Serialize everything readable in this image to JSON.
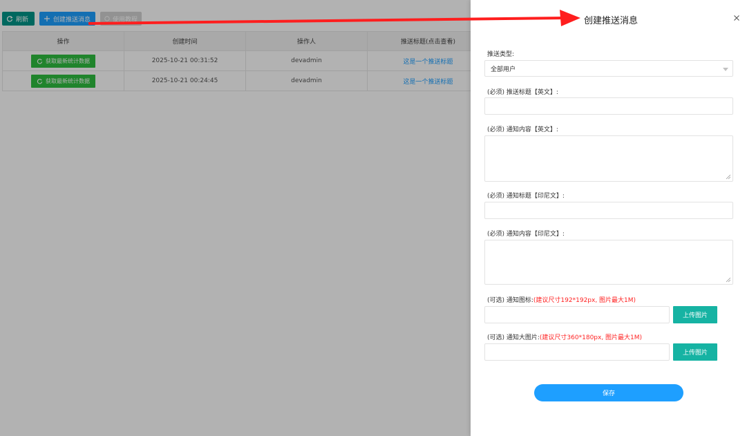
{
  "toolbar": {
    "refresh_label": "刷新",
    "create_label": "创建推送消息",
    "tutorial_label": "使用教程"
  },
  "table": {
    "headers": [
      "操作",
      "创建时间",
      "操作人",
      "推送标题(点击查看)"
    ],
    "rows": [
      {
        "action": "获取最新统计数据",
        "created": "2025-10-21 00:31:52",
        "operator": "devadmin",
        "title": "这是一个推送标题"
      },
      {
        "action": "获取最新统计数据",
        "created": "2025-10-21 00:24:45",
        "operator": "devadmin",
        "title": "这是一个推送标题"
      }
    ]
  },
  "drawer": {
    "title": "创建推送消息",
    "push_type_label": "推送类型:",
    "push_type_value": "全部用户",
    "title_en_label": "(必须) 推送标题【英文】:",
    "content_en_label": "(必须) 通知内容【英文】:",
    "title_id_label": "(必须) 通知标题【印尼文】:",
    "content_id_label": "(必须) 通知内容【印尼文】:",
    "icon_label": "(可选) 通知图标:",
    "icon_hint": "(建议尺寸192*192px, 图片最大1M)",
    "big_image_label": "(可选) 通知大图片:",
    "big_image_hint": "(建议尺寸360*180px, 图片最大1M)",
    "upload_label": "上传图片",
    "save_label": "保存"
  },
  "colors": {
    "primary": "#1e9fff",
    "teal": "#009688",
    "green": "#2ebd3f",
    "upload": "#16b3a3",
    "hint": "#ff2222",
    "annotation_arrow": "#ff1e1e"
  }
}
